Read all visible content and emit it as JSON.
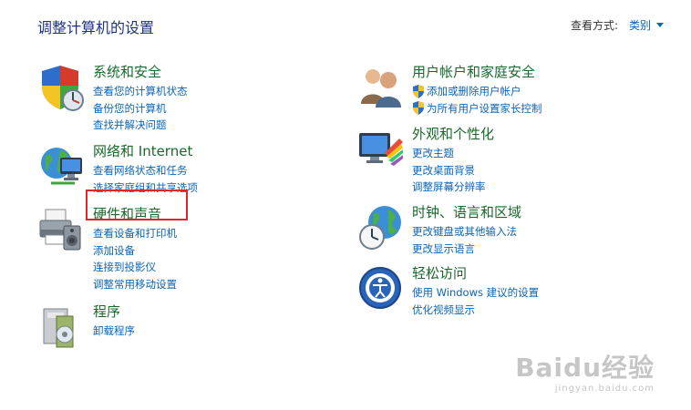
{
  "header": {
    "title": "调整计算机的设置",
    "view_by_label": "查看方式:",
    "view_by_value": "类别"
  },
  "categories": {
    "system_security": {
      "title": "系统和安全",
      "links": [
        "查看您的计算机状态",
        "备份您的计算机",
        "查找并解决问题"
      ]
    },
    "network": {
      "title": "网络和 Internet",
      "links": [
        "查看网络状态和任务",
        "选择家庭组和共享选项"
      ]
    },
    "hardware_sound": {
      "title": "硬件和声音",
      "links": [
        "查看设备和打印机",
        "添加设备",
        "连接到投影仪",
        "调整常用移动设置"
      ]
    },
    "programs": {
      "title": "程序",
      "links": [
        "卸载程序"
      ]
    },
    "user_accounts": {
      "title": "用户帐户和家庭安全",
      "links": [
        "添加或删除用户帐户",
        "为所有用户设置家长控制"
      ]
    },
    "appearance": {
      "title": "外观和个性化",
      "links": [
        "更改主题",
        "更改桌面背景",
        "调整屏幕分辨率"
      ]
    },
    "clock_region": {
      "title": "时钟、语言和区域",
      "links": [
        "更改键盘或其他输入法",
        "更改显示语言"
      ]
    },
    "ease_of_access": {
      "title": "轻松访问",
      "links": [
        "使用 Windows 建议的设置",
        "优化视频显示"
      ]
    }
  },
  "watermark": {
    "main": "Baidu经验",
    "sub": "jingyan.baidu.com"
  },
  "colors": {
    "title_blue": "#1e3287",
    "category_green": "#176a2a",
    "link_blue": "#0c64b5",
    "highlight_red": "#e0262a"
  }
}
